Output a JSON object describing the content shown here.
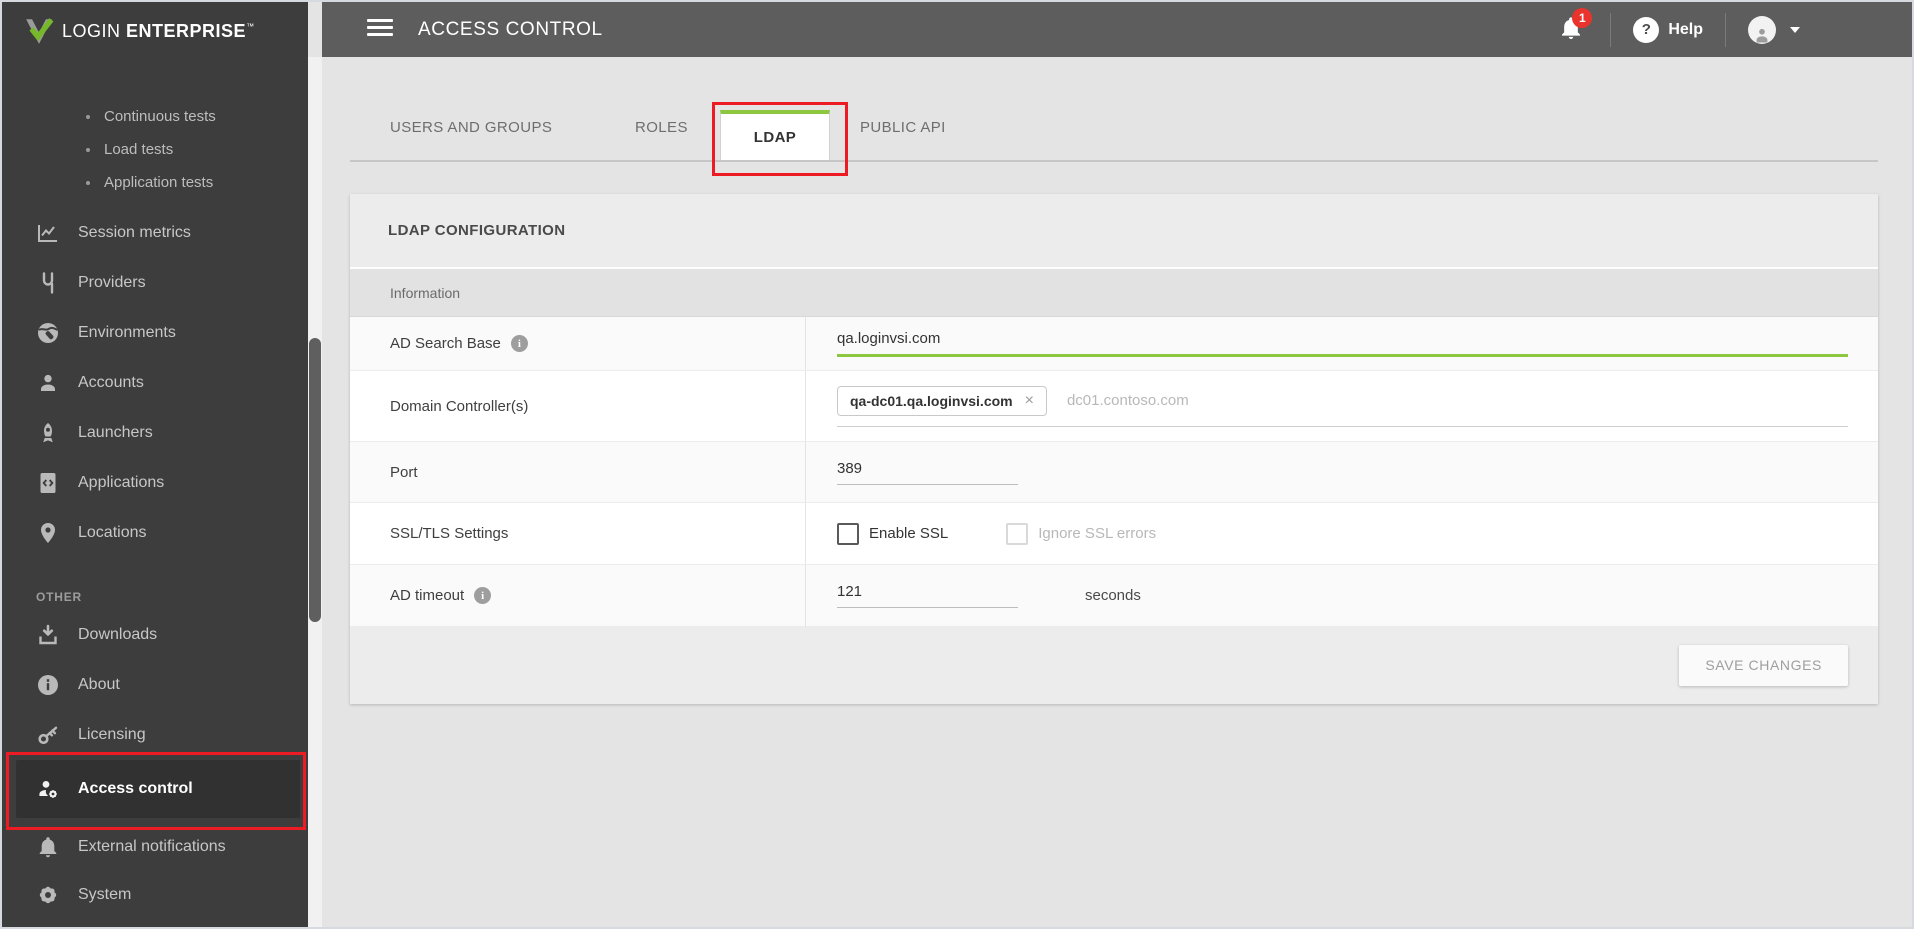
{
  "brand": {
    "name_regular": "LOGIN",
    "name_bold": "ENTERPRISE",
    "trademark": "™"
  },
  "topbar": {
    "title": "ACCESS CONTROL",
    "notification_count": "1",
    "help_label": "Help"
  },
  "sidebar": {
    "test_items": [
      {
        "label": "Continuous tests"
      },
      {
        "label": "Load tests"
      },
      {
        "label": "Application tests"
      }
    ],
    "items": [
      {
        "label": "Session metrics",
        "icon": "chart-icon"
      },
      {
        "label": "Providers",
        "icon": "plug-icon"
      },
      {
        "label": "Environments",
        "icon": "globe-icon"
      },
      {
        "label": "Accounts",
        "icon": "person-icon"
      },
      {
        "label": "Launchers",
        "icon": "rocket-icon"
      },
      {
        "label": "Applications",
        "icon": "code-file-icon"
      },
      {
        "label": "Locations",
        "icon": "location-pin-icon"
      }
    ],
    "other_heading": "OTHER",
    "other_items": [
      {
        "label": "Downloads",
        "icon": "download-icon"
      },
      {
        "label": "About",
        "icon": "info-icon"
      },
      {
        "label": "Licensing",
        "icon": "key-icon"
      },
      {
        "label": "Access control",
        "icon": "user-gear-icon",
        "active": true
      },
      {
        "label": "External notifications",
        "icon": "bell-icon"
      },
      {
        "label": "System",
        "icon": "gear-icon"
      }
    ]
  },
  "tabs": [
    {
      "label": "USERS AND GROUPS"
    },
    {
      "label": "ROLES"
    },
    {
      "label": "LDAP",
      "active": true
    },
    {
      "label": "PUBLIC API"
    }
  ],
  "ldap_card": {
    "title": "LDAP CONFIGURATION",
    "section_heading": "Information",
    "ad_search_base": {
      "label": "AD Search Base",
      "value": "qa.loginvsi.com"
    },
    "domain_controllers": {
      "label": "Domain Controller(s)",
      "chip": "qa-dc01.qa.loginvsi.com",
      "chip_remove": "×",
      "placeholder": "dc01.contoso.com"
    },
    "port": {
      "label": "Port",
      "value": "389"
    },
    "ssl": {
      "label": "SSL/TLS Settings",
      "enable_label": "Enable SSL",
      "ignore_label": "Ignore SSL errors"
    },
    "ad_timeout": {
      "label": "AD timeout",
      "value": "121",
      "suffix": "seconds"
    },
    "save_button": "SAVE CHANGES"
  },
  "colors": {
    "accent_green": "#8dc63f",
    "annotation_red": "#ed1c24",
    "badge_red": "#e8342c"
  }
}
